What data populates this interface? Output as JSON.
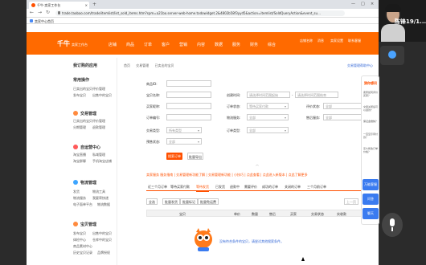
{
  "browser": {
    "tab_title": "千牛·卖家工作台",
    "tab_close": "×",
    "new_tab": "+",
    "window_controls": [
      "—",
      "□",
      "×"
    ],
    "nav_buttons": [
      "←",
      "→",
      "↻"
    ],
    "url": "trade.taobao.com/trade/itemlist/list_sold_items.htm?spm=a21bo.server-web-home.todowidget.2&4802b58f3yyd5&action=itemlist/SoldQueryAction&event_su...",
    "bookmark": "卖家中心首页"
  },
  "header": {
    "logo": "千牛",
    "logo_sub": "卖家工作台",
    "menu": [
      "店铺",
      "商品",
      "订单",
      "客户",
      "营销",
      "内容",
      "数据",
      "服务",
      "财务",
      "综合"
    ],
    "user_links": [
      "店铺名称",
      "消息",
      "卖家设置",
      "联系客服"
    ]
  },
  "sidebar": {
    "title": "我订购的应用",
    "groups": [
      {
        "heading": "常用操作",
        "items": [
          "已卖出的宝贝",
          "评价管理",
          "发布宝贝",
          "出售中的宝贝"
        ]
      },
      {
        "heading": "交易管理",
        "items": [
          "已卖出的宝贝",
          "评价管理",
          "分期管理",
          "退款管理"
        ]
      },
      {
        "heading": "自运营中心",
        "items": [
          "淘宝直播",
          "私域管理",
          "淘宝群聊",
          "手机淘宝店铺"
        ]
      },
      {
        "heading": "物流管理",
        "items": [
          "发货",
          "物流工具",
          "物流服务",
          "我要寄快递",
          "电子面单平台",
          "物流数据"
        ]
      },
      {
        "heading": "宝贝管理",
        "items": [
          "发布宝贝",
          "出售中的宝贝",
          "体检中心",
          "仓库中的宝贝",
          "商品素材中心",
          "历史宝贝记录",
          "品牌授权"
        ]
      }
    ]
  },
  "content": {
    "breadcrumb": [
      "首页",
      "交易管理",
      "已卖出的宝贝"
    ],
    "help_link": "交易管理帮助中心",
    "filters": {
      "item_name_label": "商品ID:",
      "buyer_nick_label": "宝贝名称:",
      "order_id_label": "订单编号:",
      "created_time_label": "创建时间:",
      "created_from_ph": "请选择时间范围起始",
      "created_to_ph": "请选择时间范围结束",
      "buyer_label": "买家昵称:",
      "order_status_label": "订单状态:",
      "order_status_val": "等待买家付款",
      "review_status_label": "评价状态:",
      "review_status_val": "全部",
      "order_type_label": "订单编号:",
      "logistics_label": "物流服务:",
      "logistics_val": "全部",
      "after_sale_label": "售后服务:",
      "after_sale_val": "全部",
      "delivery_label": "交易类型:",
      "delivery_val": "所有类型",
      "order_kind_label": "订单类型:",
      "order_kind_val": "全部",
      "presale_label": "预售状态:",
      "presale_val": "全部"
    },
    "search_button": "搜索订单",
    "export_button": "批量导出",
    "fold": "︿",
    "notice": "卖家服务 服务指南 | 交易管理新功能了解 | 交易管理新功能 | 小技巧 | 点此查看 | 点此进入新版本 | 点此了解更多",
    "tabs": [
      "近三个月订单",
      "等待买家付款",
      "等待发货",
      "已发货",
      "退款中",
      "需要评价",
      "成功的订单",
      "关闭的订单",
      "三个月前订单"
    ],
    "active_tab": 2,
    "toolbar": {
      "select_all": "全选",
      "batch_deliver": "批量发货",
      "batch_remark": "批量标记",
      "batch_free": "批量免运费",
      "prev": "上一页",
      "next": "下一页"
    },
    "table_headers": [
      "宝贝",
      "单价",
      "数量",
      "售后",
      "买家",
      "交易状态",
      "实收款",
      "评价"
    ],
    "empty_text": "没有符合条件的宝贝，请尝试其他搜索条件。"
  },
  "qna": {
    "title": "猜你想问",
    "items": [
      "卖家如何评价买家？",
      "交易关闭后可以退款？",
      "保证金缴纳？",
      "一直显示待付款？",
      "怎么修改订单价格？"
    ],
    "buttons": [
      "万能客服",
      "问答",
      "聊天"
    ]
  },
  "webcam": {
    "overlay_text": "陈锋19/1..."
  }
}
